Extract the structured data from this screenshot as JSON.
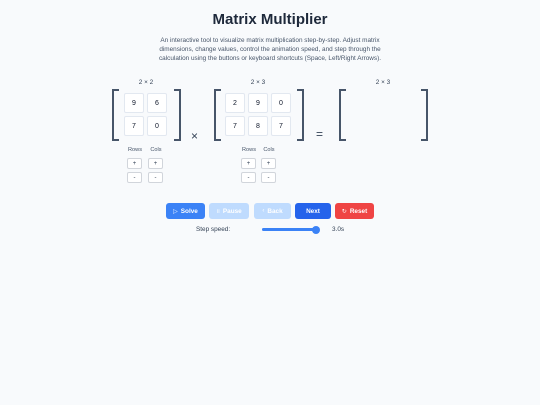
{
  "app": {
    "title": "Matrix Multiplier",
    "description": "An interactive tool to visualize matrix multiplication step-by-step. Adjust matrix dimensions, change values, control the animation speed, and step through the calculation using the buttons or keyboard shortcuts (Space, Left/Right Arrows)."
  },
  "matrices": {
    "a": {
      "dims": "2 × 2",
      "values": [
        "9",
        "6",
        "7",
        "0"
      ]
    },
    "b": {
      "dims": "2 × 3",
      "values": [
        "2",
        "9",
        "0",
        "7",
        "8",
        "7"
      ]
    },
    "result": {
      "dims": "2 × 3",
      "values": []
    }
  },
  "operators": {
    "times": "×",
    "equals": "="
  },
  "controls": {
    "rows_label": "Rows",
    "cols_label": "Cols",
    "plus": "+",
    "minus": "-"
  },
  "actions": {
    "solve": "Solve",
    "pause": "Pause",
    "back": "Back",
    "next": "Next",
    "reset": "Reset"
  },
  "speed": {
    "label": "Step speed:",
    "value_text": "3.0s",
    "level": 1.0
  },
  "colors": {
    "primary": "#3b82f6",
    "primary_dark": "#2563eb",
    "disabled": "#bfdbfe",
    "danger": "#ef4444"
  }
}
